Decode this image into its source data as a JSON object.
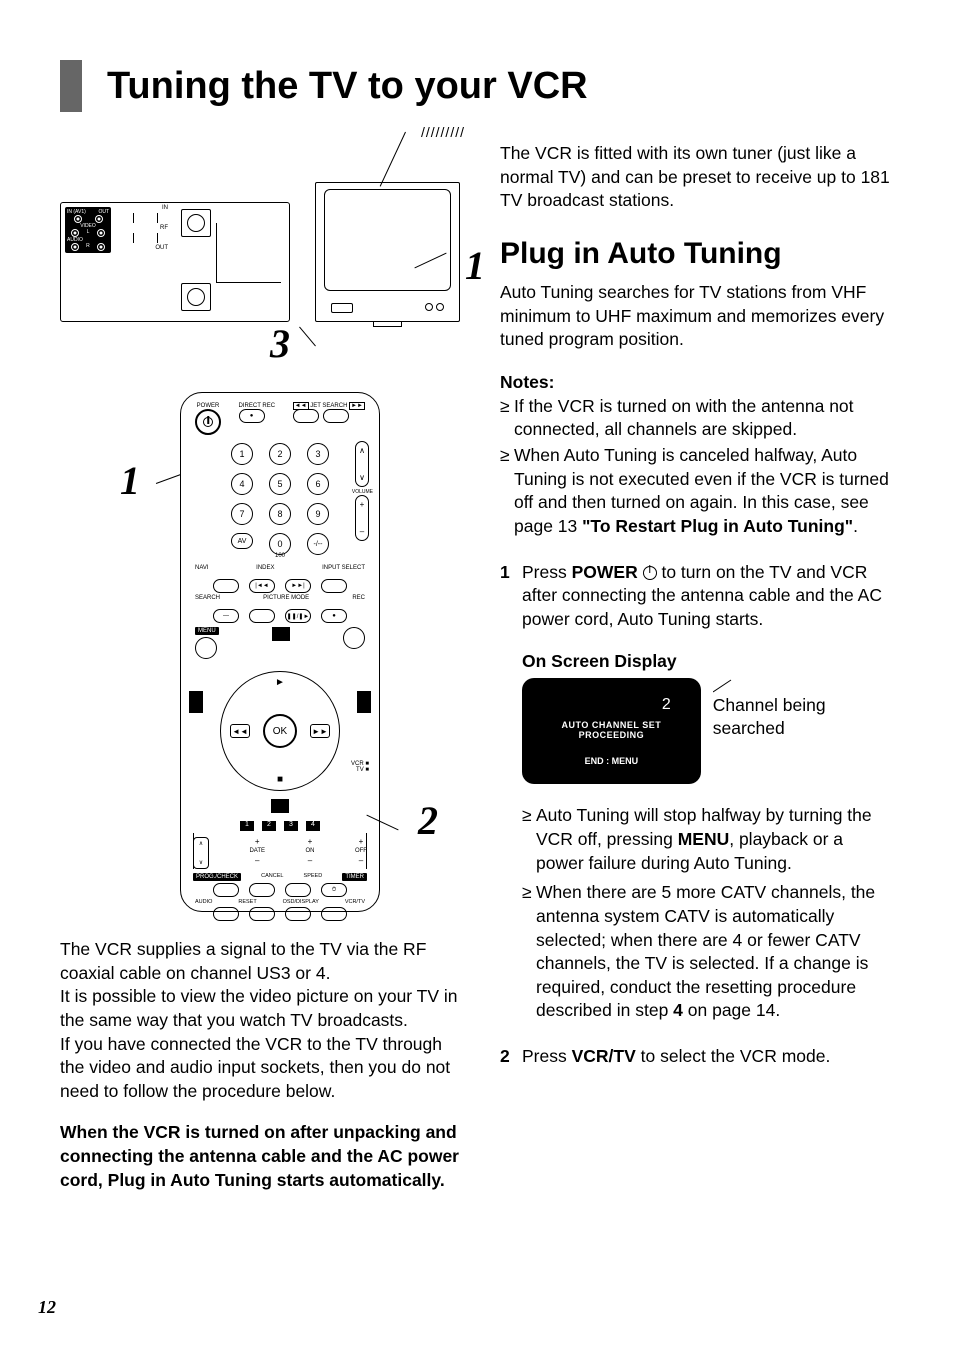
{
  "header": {
    "title": "Tuning the TV to your VCR"
  },
  "diagram1": {
    "callout1": "1",
    "callout3": "3",
    "vcr_labels": {
      "in_av1": "IN (AV1)",
      "out": "OUT",
      "video": "VIDEO",
      "l": "L",
      "r": "R",
      "audio": "AUDIO",
      "in": "IN",
      "rf": "RF",
      "out2": "OUT"
    }
  },
  "remote": {
    "callout1": "1",
    "callout2": "2",
    "labels": {
      "power": "POWER",
      "direct_rec": "DIRECT REC",
      "jet_search": "JET SEARCH",
      "volume": "VOLUME",
      "av": "AV",
      "navi": "NAVI",
      "index": "INDEX",
      "input_select": "INPUT SELECT",
      "search": "SEARCH",
      "picture_mode": "PICTURE MODE",
      "rec": "REC",
      "menu": "MENU",
      "ok": "OK",
      "vcr": "VCR",
      "tv": "TV",
      "date": "DATE",
      "on": "ON",
      "off": "OFF",
      "prog_check": "PROG./CHECK",
      "cancel": "CANCEL",
      "speed": "SPEED",
      "timer": "TIMER",
      "audio": "AUDIO",
      "reset": "RESET",
      "osd_display": "OSD/DISPLAY",
      "vcr_tv": "VCR/TV",
      "hundred": "100"
    },
    "numpad": [
      "1",
      "2",
      "3",
      "4",
      "5",
      "6",
      "7",
      "8",
      "9",
      "0"
    ],
    "prog_nums": [
      "1",
      "2",
      "3",
      "4"
    ]
  },
  "left_text": {
    "p1": "The VCR supplies a signal to the TV via the RF coaxial cable on channel US3 or 4.",
    "p2": "It is possible to view the video picture on your TV in the same way that you watch TV broadcasts.",
    "p3": "If you have connected the VCR to the TV through the video and audio input sockets, then you do not need to follow the procedure below.",
    "bold": "When the VCR is turned on after unpacking and connecting the antenna cable and the AC power cord, Plug in Auto Tuning starts automatically."
  },
  "right_text": {
    "p1": "The VCR is fitted with its own tuner (just like a normal TV) and can be preset to receive up to 181 TV broadcast stations.",
    "section_title": "Plug in Auto Tuning",
    "p2": "Auto Tuning searches for TV stations from VHF minimum to UHF maximum and memorizes every tuned program position.",
    "notes_head": "Notes:",
    "note1": "If the VCR is turned on with the antenna not connected, all channels are skipped.",
    "note2_a": "When Auto Tuning is canceled halfway, Auto Tuning is not executed even if the VCR is turned off and then turned on again. In this case, see page 13 ",
    "note2_bold": "\"To Restart Plug in Auto Tuning\"",
    "note2_end": ".",
    "step1_num": "1",
    "step1_a": "Press ",
    "step1_power": "POWER",
    "step1_b": " to turn on the TV and VCR after connecting the antenna cable and the AC power cord, Auto Tuning starts.",
    "osd_head": "On Screen Display",
    "osd": {
      "channel_num": "2",
      "line1": "AUTO CHANNEL SET",
      "line2": "PROCEEDING",
      "line3": "END         :  MENU"
    },
    "osd_callout": "Channel being searched",
    "sub1_a": "Auto Tuning will stop halfway by turning the VCR off, pressing ",
    "sub1_menu": "MENU",
    "sub1_b": ", playback or a power failure during Auto Tuning.",
    "sub2_a": "When there are 5 more CATV channels, the antenna system CATV is automatically selected; when there are 4 or fewer CATV channels, the TV is selected. If a change is required, conduct the resetting procedure described in step ",
    "sub2_bold": "4",
    "sub2_b": " on page 14.",
    "step2_num": "2",
    "step2_a": "Press ",
    "step2_vcrtv": "VCR/TV",
    "step2_b": " to select the VCR mode."
  },
  "page_number": "12"
}
